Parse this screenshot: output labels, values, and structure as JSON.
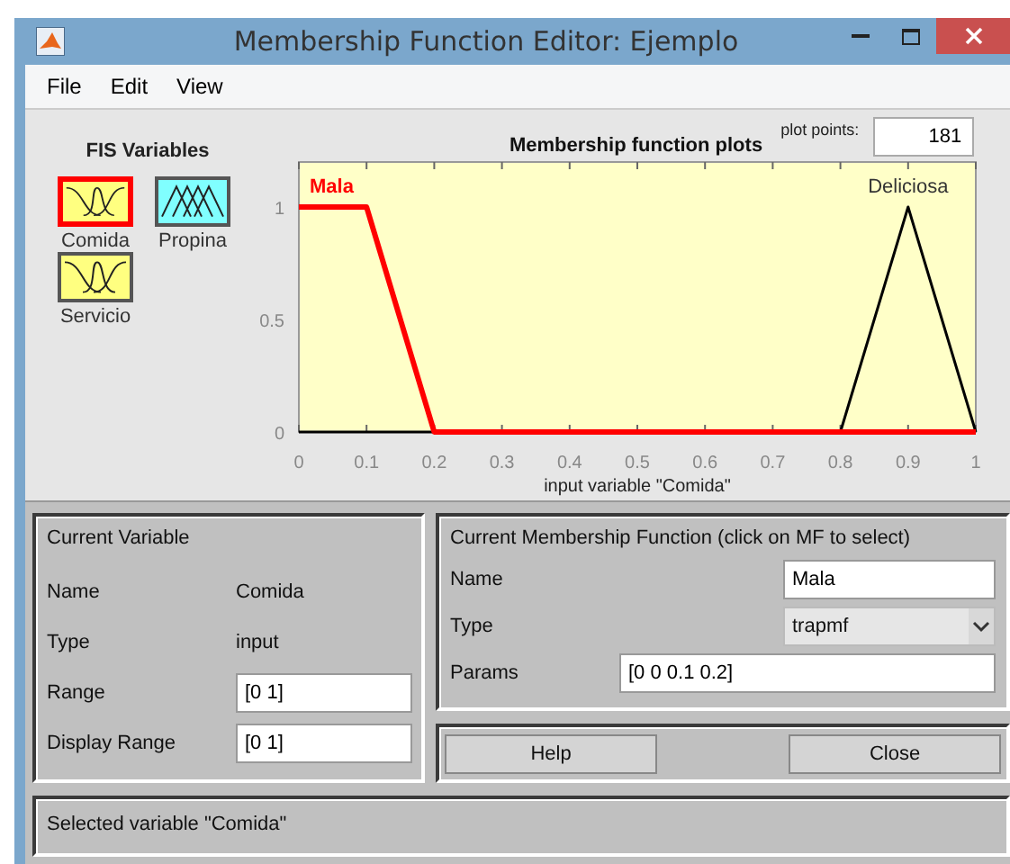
{
  "window": {
    "title": "Membership Function Editor: Ejemplo"
  },
  "menu": [
    "File",
    "Edit",
    "View"
  ],
  "fis_variables": {
    "title": "FIS Variables",
    "items": [
      {
        "name": "Comida",
        "kind": "input",
        "selected": true
      },
      {
        "name": "Propina",
        "kind": "output",
        "selected": false
      },
      {
        "name": "Servicio",
        "kind": "input",
        "selected": false
      }
    ]
  },
  "plot": {
    "title": "Membership function plots",
    "plot_points_label": "plot points:",
    "plot_points": "181",
    "chart_data": {
      "type": "line",
      "xlabel": "input variable \"Comida\"",
      "x": [
        0,
        0.1,
        0.2,
        0.8,
        0.9,
        1
      ],
      "series": [
        {
          "name": "Mala",
          "color": "#ff0000",
          "values": [
            1,
            1,
            0,
            0,
            0,
            0
          ]
        },
        {
          "name": "Deliciosa",
          "color": "#000000",
          "values": [
            0,
            0,
            0,
            0,
            1,
            0
          ]
        }
      ],
      "xlim": [
        0,
        1
      ],
      "ylim": [
        0,
        1.2
      ],
      "xticks": [
        0,
        0.1,
        0.2,
        0.3,
        0.4,
        0.5,
        0.6,
        0.7,
        0.8,
        0.9,
        1
      ],
      "yticks": [
        0,
        0.5,
        1
      ]
    }
  },
  "current_variable": {
    "title": "Current Variable",
    "name_label": "Name",
    "name": "Comida",
    "type_label": "Type",
    "type": "input",
    "range_label": "Range",
    "range": "[0 1]",
    "display_range_label": "Display Range",
    "display_range": "[0 1]"
  },
  "current_mf": {
    "title": "Current Membership Function (click on MF to select)",
    "name_label": "Name",
    "name": "Mala",
    "type_label": "Type",
    "type": "trapmf",
    "params_label": "Params",
    "params": "[0 0 0.1 0.2]"
  },
  "buttons": [
    "Help",
    "Close"
  ],
  "status": "Selected variable \"Comida\""
}
